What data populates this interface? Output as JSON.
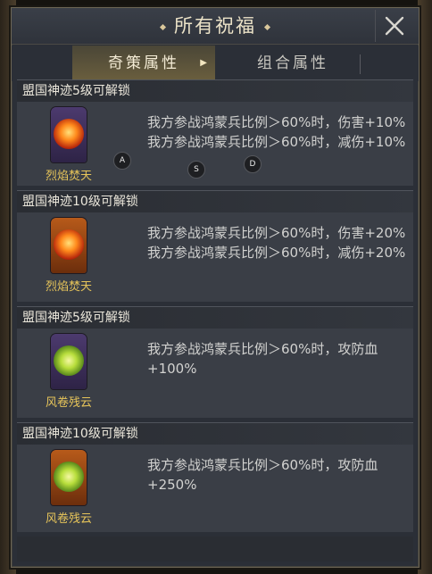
{
  "window": {
    "title": "所有祝福"
  },
  "tabs": [
    {
      "label": "奇策属性",
      "active": true
    },
    {
      "label": "组合属性",
      "active": false
    }
  ],
  "cards": [
    {
      "header": "盟国神迹5级可解锁",
      "icon": {
        "name": "fire-emblem-icon",
        "frame": "purple",
        "label": "烈焰焚天"
      },
      "lines": [
        "我方参战鸿蒙兵比例＞60%时，伤害+10%",
        "我方参战鸿蒙兵比例＞60%时，减伤+10%"
      ]
    },
    {
      "header": "盟国神迹10级可解锁",
      "icon": {
        "name": "fire-emblem-icon",
        "frame": "orange",
        "label": "烈焰焚天"
      },
      "lines": [
        "我方参战鸿蒙兵比例＞60%时，伤害+20%",
        "我方参战鸿蒙兵比例＞60%时，减伤+20%"
      ]
    },
    {
      "header": "盟国神迹5级可解锁",
      "icon": {
        "name": "wind-emblem-icon",
        "frame": "purple",
        "label": "风卷残云"
      },
      "lines": [
        "我方参战鸿蒙兵比例＞60%时，攻防血",
        "+100%"
      ]
    },
    {
      "header": "盟国神迹10级可解锁",
      "icon": {
        "name": "wind-emblem-icon",
        "frame": "orange",
        "label": "风卷残云"
      },
      "lines": [
        "我方参战鸿蒙兵比例＞60%时，攻防血",
        "+250%"
      ]
    }
  ],
  "markers": [
    "A",
    "S",
    "D"
  ],
  "colors": {
    "accent_gold": "#d7bf7c",
    "icon_label": "#e6c45a",
    "panel": "#2b2f37",
    "card": "#3a3e46"
  }
}
